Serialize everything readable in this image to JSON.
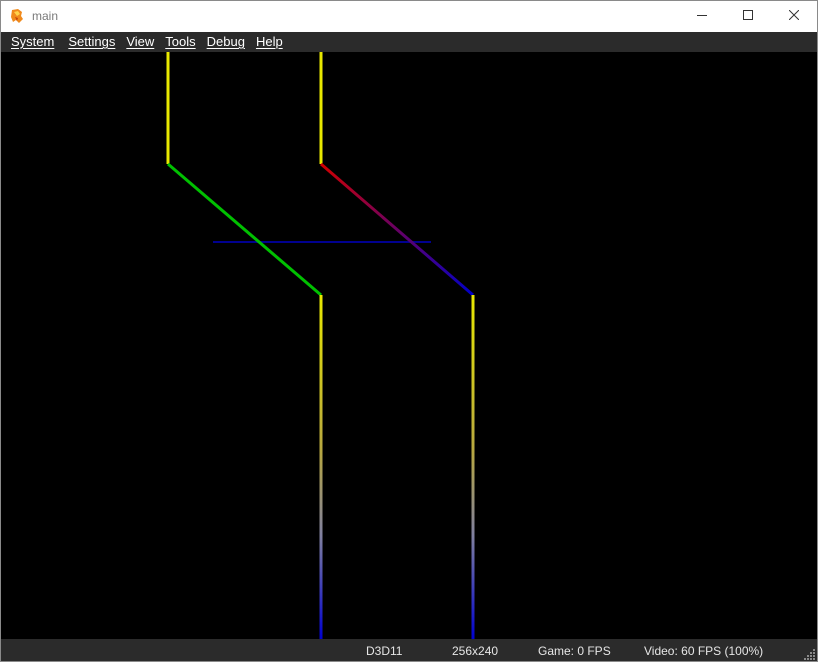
{
  "window": {
    "title": "main"
  },
  "icons": {
    "app": "ares-emulator-icon",
    "minimize": "minimize-icon",
    "maximize": "maximize-icon",
    "close": "close-icon",
    "resize_grip": "resize-grip-icon"
  },
  "menu": {
    "items": [
      {
        "label": "System"
      },
      {
        "label": "Settings"
      },
      {
        "label": "View"
      },
      {
        "label": "Tools"
      },
      {
        "label": "Debug"
      },
      {
        "label": "Help"
      }
    ]
  },
  "statusbar": {
    "driver": "D3D11",
    "resolution": "256x240",
    "game_fps": "Game: 0 FPS",
    "video_fps": "Video: 60 FPS (100%)"
  },
  "colors": {
    "chrome_dark": "#2b2b2b",
    "viewport_bg": "#000000",
    "line_yellow": "#e8e800",
    "line_green": "#00c000",
    "line_red": "#d00000",
    "line_blue": "#0000c8",
    "line_navy": "#000090"
  }
}
